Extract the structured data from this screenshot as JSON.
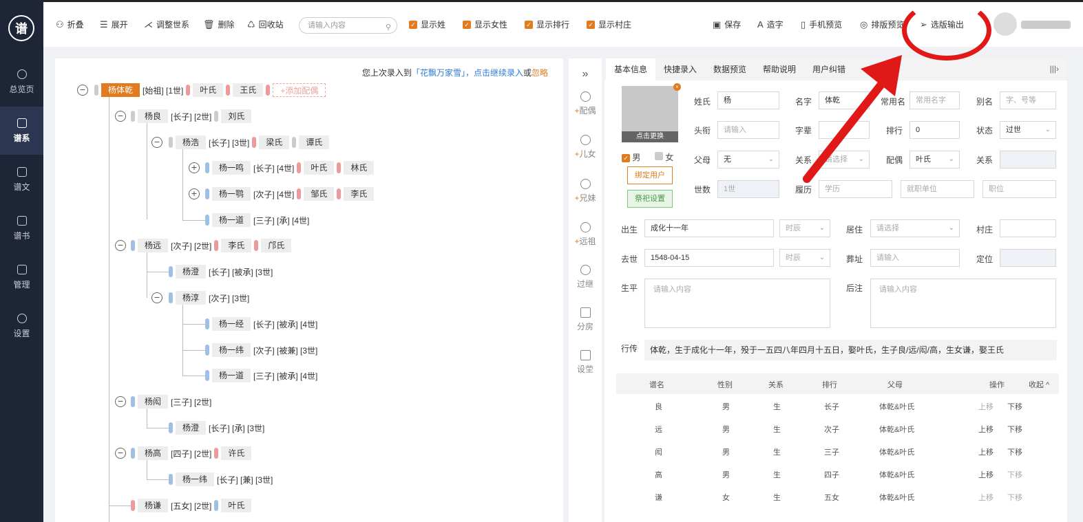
{
  "sidebar": {
    "logo": "谱",
    "items": [
      {
        "label": "总览页"
      },
      {
        "label": "谱系"
      },
      {
        "label": "谱文"
      },
      {
        "label": "谱书"
      },
      {
        "label": "管理"
      },
      {
        "label": "设置"
      }
    ]
  },
  "toolbar": {
    "fold": "折叠",
    "expand": "展开",
    "adjust": "调整世系",
    "delete": "删除",
    "recycle": "回收站",
    "search_placeholder": "请输入内容",
    "show_surname": "显示姓",
    "show_female": "显示女性",
    "show_rank": "显示排行",
    "show_village": "显示村庄",
    "save": "保存",
    "create_char": "造字",
    "mobile_preview": "手机预览",
    "layout_preview": "排版预览",
    "export": "选版输出"
  },
  "notice": {
    "prefix": "您上次录入到",
    "link": "「花飘万家雪」",
    "cont": "，点击继续录入",
    "or": "或",
    "ignore": "忽略"
  },
  "tree": [
    {
      "name": "杨体乾",
      "tag": "[始祖] [1世]",
      "sp1": "叶氏",
      "sp2": "王氏",
      "add": "+添加配偶"
    },
    {
      "name": "杨良",
      "tag": "[长子] [2世]",
      "sp1": "刘氏"
    },
    {
      "name": "杨浩",
      "tag": "[长子] [3世]",
      "sp1": "梁氏",
      "sp2": "谭氏"
    },
    {
      "name": "杨一鸣",
      "tag": "[长子] [4世]",
      "sp1": "叶氏",
      "sp2": "林氏"
    },
    {
      "name": "杨一鹗",
      "tag": "[次子] [4世]",
      "sp1": "邹氏",
      "sp2": "李氏"
    },
    {
      "name": "杨一道",
      "tag": "[三子] [承] [4世]"
    },
    {
      "name": "杨远",
      "tag": "[次子] [2世]",
      "sp1": "李氏",
      "sp2": "邝氏"
    },
    {
      "name": "杨澄",
      "tag": "[长子] [被承] [3世]"
    },
    {
      "name": "杨淳",
      "tag": "[次子] [3世]"
    },
    {
      "name": "杨一经",
      "tag": "[长子] [被承] [4世]"
    },
    {
      "name": "杨一纬",
      "tag": "[次子] [被兼] [3世]"
    },
    {
      "name": "杨一道",
      "tag": "[三子] [被承] [4世]"
    },
    {
      "name": "杨闳",
      "tag": "[三子] [2世]"
    },
    {
      "name": "杨澄",
      "tag": "[长子] [承] [3世]"
    },
    {
      "name": "杨高",
      "tag": "[四子] [2世]",
      "sp1": "许氏"
    },
    {
      "name": "杨一纬",
      "tag": "[长子] [兼] [3世]"
    },
    {
      "name": "杨谦",
      "tag": "[五女] [2世]",
      "sp1": "叶氏"
    }
  ],
  "midbar": [
    {
      "label": "配偶",
      "plus": "+"
    },
    {
      "label": "儿女",
      "plus": "+"
    },
    {
      "label": "兄妹",
      "plus": "+"
    },
    {
      "label": "远祖",
      "plus": "+"
    },
    {
      "label": "过继",
      "plus": ""
    },
    {
      "label": "分房",
      "plus": ""
    },
    {
      "label": "设茔",
      "plus": ""
    }
  ],
  "tabs": [
    "基本信息",
    "快捷录入",
    "数据预览",
    "帮助说明",
    "用户纠错"
  ],
  "form": {
    "photo_caption": "点击更换",
    "male": "男",
    "female": "女",
    "bind_user": "绑定用户",
    "ritual": "祭祀设置",
    "surname_l": "姓氏",
    "surname_v": "杨",
    "given_l": "名字",
    "given_v": "体乾",
    "common_l": "常用名",
    "common_ph": "常用名字",
    "alias_l": "别名",
    "alias_ph": "字、号等",
    "title_l": "头衔",
    "title_ph": "请输入",
    "zibei_l": "字辈",
    "rank_l": "排行",
    "rank_v": "0",
    "status_l": "状态",
    "status_v": "过世",
    "parent_l": "父母",
    "parent_v": "无",
    "rel_l": "关系",
    "rel_ph": "请选择",
    "spouse_l": "配偶",
    "spouse_v": "叶氏",
    "rel2_l": "关系",
    "gen_l": "世数",
    "gen_v": "1世",
    "resume_l": "履历",
    "edu_ph": "学历",
    "work_ph": "就职单位",
    "pos_ph": "职位",
    "birth_l": "出生",
    "birth_v": "成化十一年",
    "time_ph": "时辰",
    "live_l": "居住",
    "live_ph": "请选择",
    "village_l": "村庄",
    "death_l": "去世",
    "death_v": "1548-04-15",
    "burial_l": "葬址",
    "burial_ph": "请输入",
    "locate_l": "定位",
    "life_l": "生平",
    "life_ph": "请输入内容",
    "note_l": "后注",
    "note_ph": "请输入内容",
    "bio_l": "行传",
    "bio_v": "体乾，生于成化十一年，殁于一五四八年四月十五日，娶叶氏，生子良/远/闳/高，生女谦，娶王氏"
  },
  "table": {
    "headers": [
      "谱名",
      "性别",
      "关系",
      "排行",
      "父母",
      "操作",
      "收起 ^"
    ],
    "rows": [
      [
        "良",
        "男",
        "生",
        "长子",
        "体乾&叶氏",
        "上移",
        "下移"
      ],
      [
        "远",
        "男",
        "生",
        "次子",
        "体乾&叶氏",
        "上移",
        "下移"
      ],
      [
        "闳",
        "男",
        "生",
        "三子",
        "体乾&叶氏",
        "上移",
        "下移"
      ],
      [
        "高",
        "男",
        "生",
        "四子",
        "体乾&叶氏",
        "上移",
        "下移"
      ],
      [
        "谦",
        "女",
        "生",
        "五女",
        "体乾&叶氏",
        "上移",
        "下移"
      ]
    ]
  }
}
